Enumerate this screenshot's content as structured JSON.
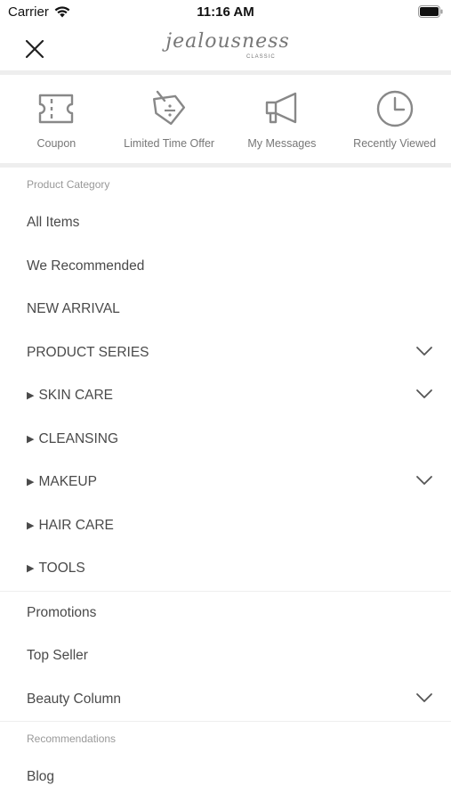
{
  "status_bar": {
    "carrier": "Carrier",
    "time": "11:16 AM"
  },
  "header": {
    "logo_text": "jealousness",
    "logo_sub": "CLASSIC"
  },
  "quick_links": [
    {
      "label": "Coupon",
      "icon": "coupon-icon"
    },
    {
      "label": "Limited Time Offer",
      "icon": "price-tag-icon"
    },
    {
      "label": "My Messages",
      "icon": "megaphone-icon"
    },
    {
      "label": "Recently Viewed",
      "icon": "clock-icon"
    }
  ],
  "product_category": {
    "title": "Product Category",
    "items": [
      {
        "label": "All Items"
      },
      {
        "label": "We Recommended"
      },
      {
        "label": "NEW ARRIVAL"
      },
      {
        "label": "PRODUCT SERIES",
        "expandable": true
      },
      {
        "label": "SKIN CARE",
        "sub": true,
        "expandable": true
      },
      {
        "label": "CLEANSING",
        "sub": true
      },
      {
        "label": "MAKEUP",
        "sub": true,
        "expandable": true
      },
      {
        "label": "HAIR CARE",
        "sub": true
      },
      {
        "label": "TOOLS",
        "sub": true
      }
    ]
  },
  "more_items": [
    {
      "label": "Promotions"
    },
    {
      "label": "Top Seller"
    },
    {
      "label": "Beauty Column",
      "expandable": true
    }
  ],
  "recommendations": {
    "title": "Recommendations",
    "items": [
      {
        "label": "Blog"
      }
    ]
  },
  "colors": {
    "icon_gray": "#888888",
    "divider": "#eeeeee",
    "text": "#4a4a4a",
    "section_title": "#999999"
  }
}
